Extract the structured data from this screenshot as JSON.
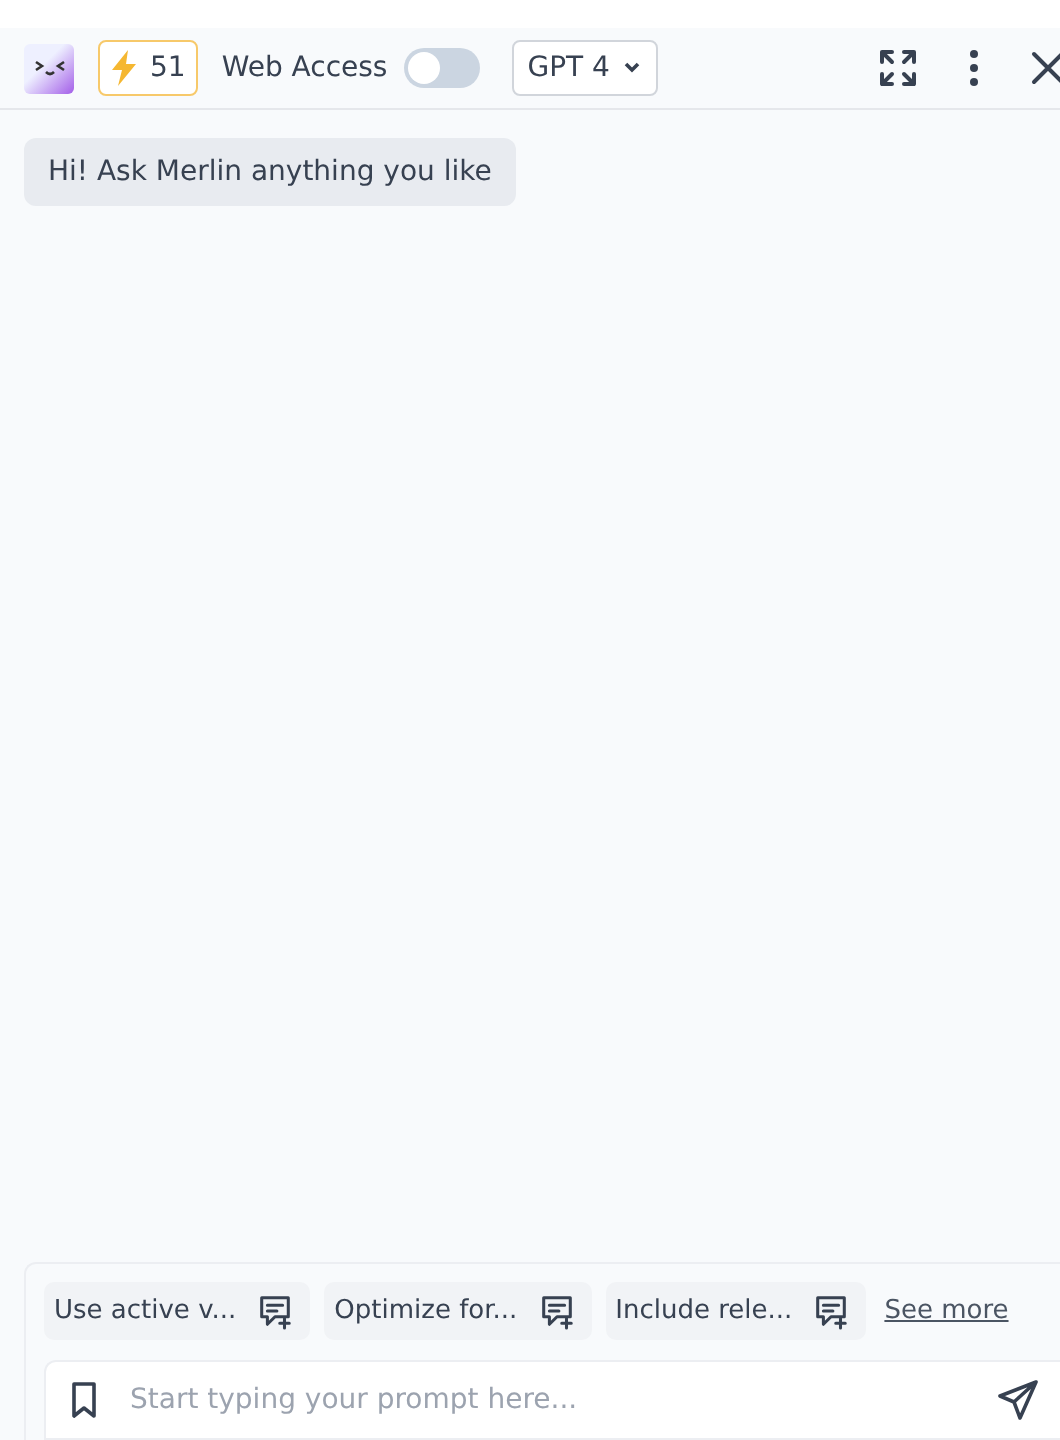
{
  "header": {
    "credits": "51",
    "web_access": {
      "label": "Web Access",
      "on": false
    },
    "model": "GPT 4"
  },
  "messages": [
    {
      "text": "Hi! Ask Merlin anything you like"
    }
  ],
  "suggestions": [
    "Use active v...",
    "Optimize for...",
    "Include rele..."
  ],
  "see_more": "See more",
  "prompt": {
    "placeholder": "Start typing your prompt here..."
  }
}
